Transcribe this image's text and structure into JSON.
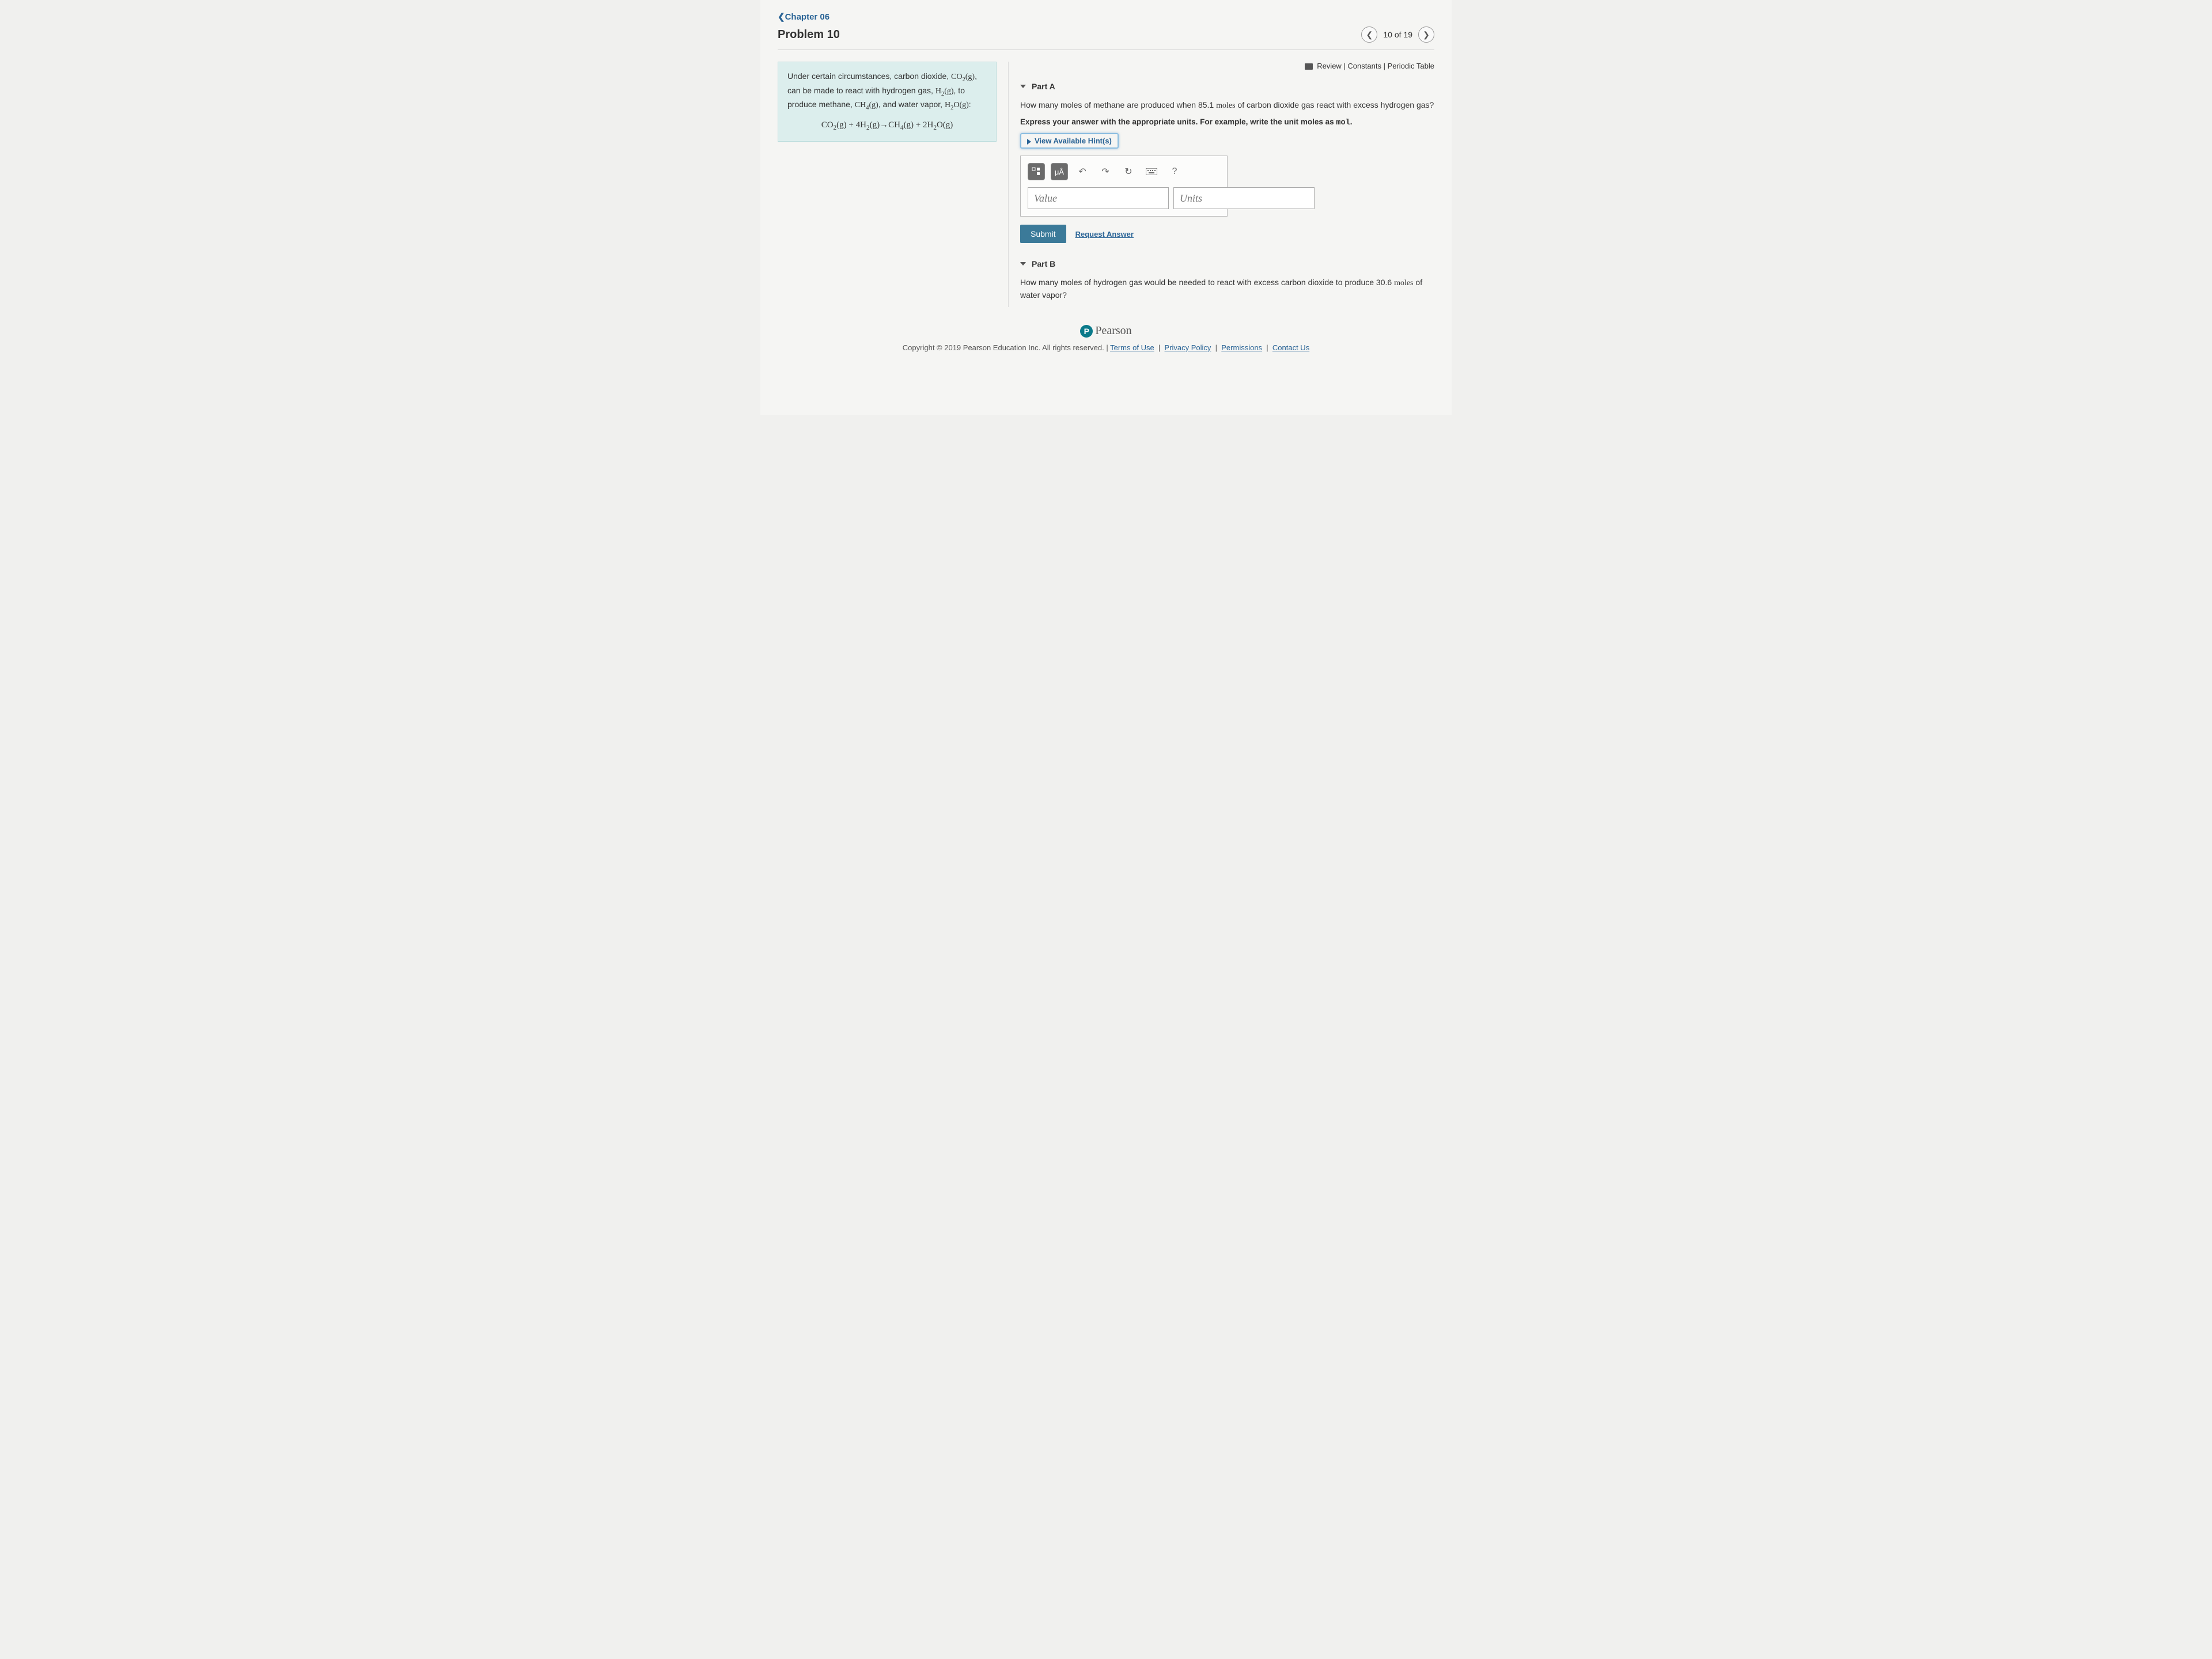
{
  "nav": {
    "chapter_link": "Chapter 06",
    "problem_title": "Problem 10",
    "position": "10 of 19"
  },
  "refs": {
    "review": "Review",
    "constants": "Constants",
    "periodic": "Periodic Table"
  },
  "prompt": {
    "intro": "Under certain circumstances, carbon dioxide, CO₂(g), can be made to react with hydrogen gas, H₂(g), to produce methane, CH₄(g), and water vapor, H₂O(g):",
    "equation": "CO₂(g) + 4H₂(g) → CH₄(g) + 2H₂O(g)"
  },
  "partA": {
    "label": "Part A",
    "question_pre": "How many moles of methane are produced when 85.1 ",
    "question_unit": "moles",
    "question_post": " of carbon dioxide gas react with excess hydrogen gas?",
    "instruction": "Express your answer with the appropriate units. For example, write the unit moles as ",
    "instruction_mono": "mol",
    "hints": "View Available Hint(s)",
    "value_placeholder": "Value",
    "units_placeholder": "Units",
    "submit": "Submit",
    "request": "Request Answer",
    "tool_special": "μÅ",
    "tool_help": "?"
  },
  "partB": {
    "label": "Part B",
    "question_pre": "How many moles of hydrogen gas would be needed to react with excess carbon dioxide to produce 30.6 ",
    "question_unit": "moles",
    "question_post": " of water vapor?"
  },
  "footer": {
    "brand": "Pearson",
    "copyright": "Copyright © 2019 Pearson Education Inc. All rights reserved. | ",
    "links": {
      "terms": "Terms of Use",
      "privacy": "Privacy Policy",
      "permissions": "Permissions",
      "contact": "Contact Us"
    }
  }
}
